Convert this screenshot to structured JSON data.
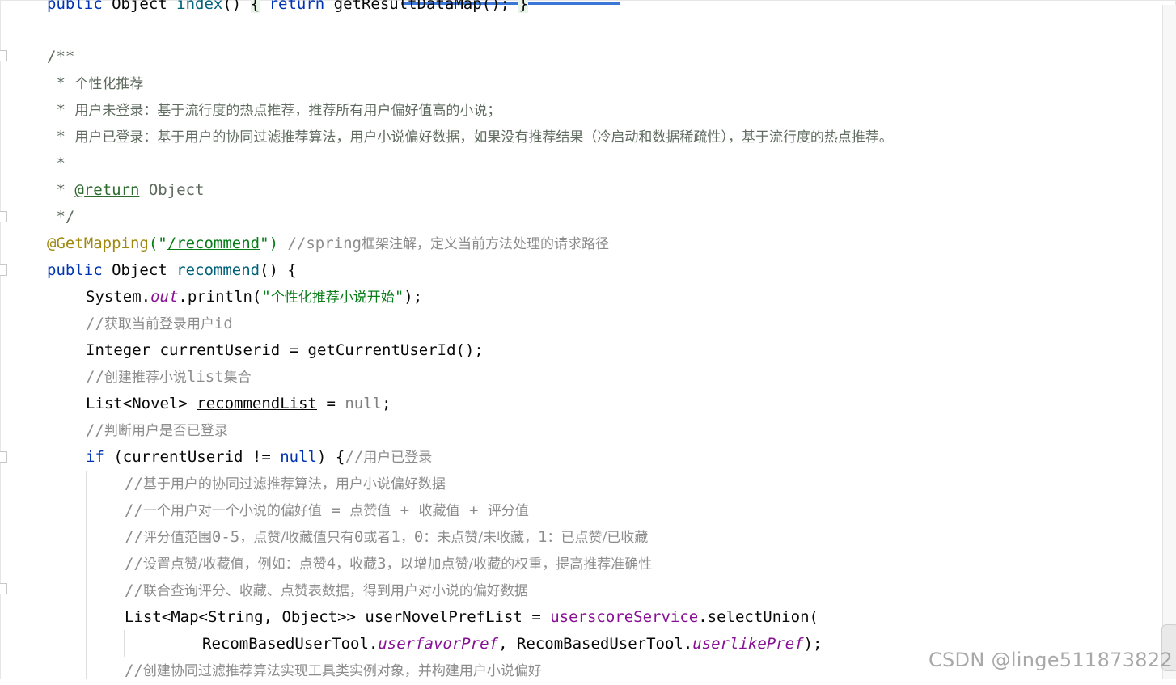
{
  "lines": {
    "l0": {
      "kw": "public",
      "type": " Object ",
      "method": "index",
      "paren": "() ",
      "brace_open": "{",
      "kw_return": " return ",
      "call": "getResultDataMap",
      "tail": "(); ",
      "brace_close": "}"
    },
    "l1": "/**",
    "l2": {
      "star": " * ",
      "text": "个性化推荐"
    },
    "l3": {
      "star": " * ",
      "text": "用户未登录：基于流行度的热点推荐，推荐所有用户偏好值高的小说；"
    },
    "l4": {
      "star": " * ",
      "text": "用户已登录：基于用户的协同过滤推荐算法，用户小说偏好数据，如果没有推荐结果（冷启动和数据稀疏性），基于流行度的热点推荐。"
    },
    "l5": " *",
    "l6": {
      "star": " * ",
      "tag": "@return",
      "rest": " Object"
    },
    "l7": " */",
    "l8": {
      "ann": "@GetMapping",
      "p1": "(\"",
      "path": "/recommend",
      "p2": "\")",
      "space": " ",
      "comment": "//spring",
      "comment_cn": "框架注解，定义当前方法处理的请求路径"
    },
    "l9": {
      "kw": "public",
      "type": " Object ",
      "method": "recommend",
      "tail": "() {"
    },
    "l10": {
      "a": "System.",
      "field": "out",
      "b": ".println(",
      "str_q1": "\"",
      "str_cn": "个性化推荐小说开始",
      "str_q2": "\"",
      "c": ");"
    },
    "l11": {
      "comment": "//",
      "cn": "获取当前登录用户",
      "en": "id"
    },
    "l12": "Integer currentUserid = getCurrentUserId();",
    "l13": {
      "comment": "//",
      "cn1": "创建推荐小说",
      "en": "list",
      "cn2": "集合"
    },
    "l14": {
      "a": "List<Novel> ",
      "var": "recommendList",
      "b": " = ",
      "null": "null",
      "c": ";"
    },
    "l15": {
      "comment": "//",
      "cn": "判断用户是否已登录"
    },
    "l16": {
      "kw": "if",
      "a": " (currentUserid != ",
      "null": "null",
      "b": ") {",
      "comment": "//",
      "cn": "用户已登录"
    },
    "l17": {
      "comment": "//",
      "cn": "基于用户的协同过滤推荐算法，用户小说偏好数据"
    },
    "l18": {
      "comment": "//",
      "cn1": "一个用户对一个小说的偏好值",
      "eq": " = ",
      "cn2": "点赞值",
      "p1": " + ",
      "cn3": "收藏值",
      "p2": " + ",
      "cn4": "评分值"
    },
    "l19": {
      "comment": "//",
      "cn1": "评分值范围",
      "n1": "0-5",
      "cn2": "，点赞/收藏值只有",
      "n2": "0",
      "cn3": "或者",
      "n3": "1",
      "cn4": "，",
      "n4": "0",
      "cn5": "：未点赞/未收藏，",
      "n5": "1",
      "cn6": "：已点赞/已收藏"
    },
    "l20": {
      "comment": "//",
      "cn1": "设置点赞/收藏值，例如：点赞",
      "n1": "4",
      "cn2": "，收藏",
      "n2": "3",
      "cn3": "，以增加点赞/收藏的权重，提高推荐准确性"
    },
    "l21": {
      "comment": "//",
      "cn": "联合查询评分、收藏、点赞表数据，得到用户对小说的偏好数据"
    },
    "l22": {
      "a": "List<Map<String, Object>> userNovelPrefList = ",
      "field": "userscoreService",
      "b": ".selectUnion("
    },
    "l23": {
      "a": "RecomBasedUserTool.",
      "f1": "userfavorPref",
      "b": ", RecomBasedUserTool.",
      "f2": "userlikePref",
      "c": ");"
    },
    "l24": {
      "comment": "//",
      "cn": "创建协同过滤推荐算法实现工具类实例对象，并构建用户小说偏好"
    }
  },
  "watermark": "CSDN @linge511873822"
}
